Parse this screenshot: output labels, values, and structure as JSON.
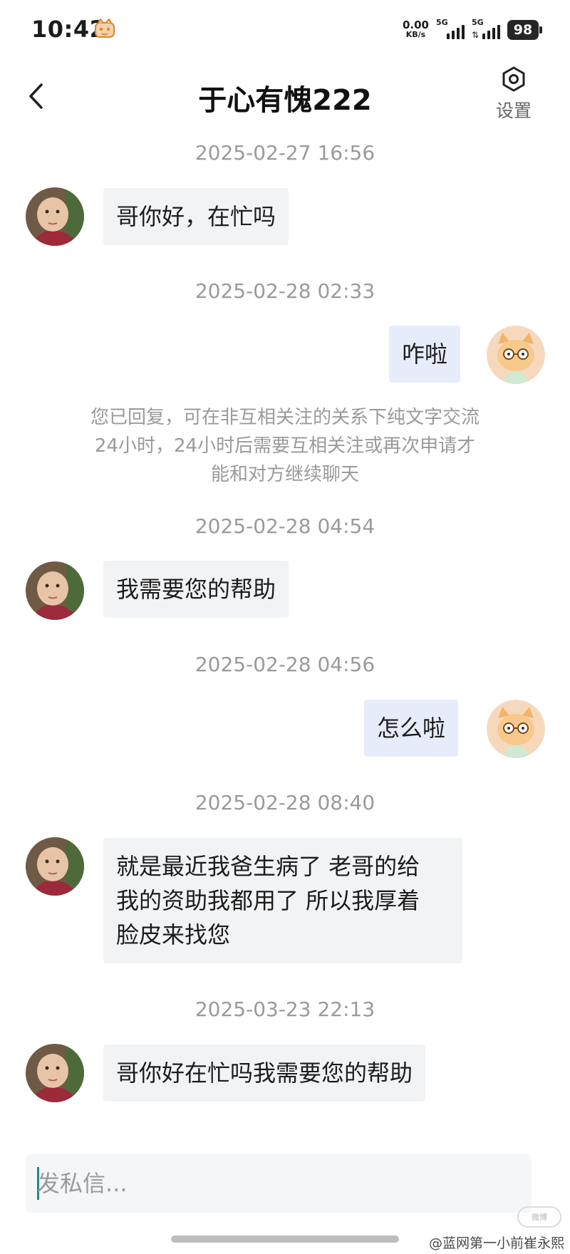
{
  "status_bar": {
    "time": "10:42",
    "net_speed_value": "0.00",
    "net_speed_unit": "KB/s",
    "signal_1_label": "5G",
    "signal_2_label": "5G",
    "battery": "98"
  },
  "header": {
    "back_icon": "chevron-left-icon",
    "title": "于心有愧222",
    "settings_icon": "hexagon-gear-icon",
    "settings_label": "设置"
  },
  "messages": [
    {
      "timestamp": "2025-02-27 16:56",
      "side": "left",
      "text": "哥你好，在忙吗"
    },
    {
      "timestamp": "2025-02-28 02:33",
      "side": "right",
      "text": "咋啦"
    },
    {
      "timestamp": "2025-02-28 04:54",
      "side": "left",
      "text": "我需要您的帮助"
    },
    {
      "timestamp": "2025-02-28 04:56",
      "side": "right",
      "text": "怎么啦"
    },
    {
      "timestamp": "2025-02-28 08:40",
      "side": "left",
      "lines": [
        "就是最近我爸生病了 老哥的给",
        "我的资助我都用了 所以我厚着",
        "脸皮来找您"
      ]
    },
    {
      "timestamp": "2025-03-23 22:13",
      "side": "left",
      "text": "哥你好在忙吗我需要您的帮助"
    }
  ],
  "system_notice": {
    "lines": [
      "您已回复，可在非互相关注的关系下纯文字交流",
      "24小时，24小时后需要互相关注或再次申请才",
      "能和对方继续聊天"
    ]
  },
  "composer": {
    "placeholder": "发私信..."
  },
  "watermark": {
    "text": "@蓝网第一小前崔永熙"
  }
}
